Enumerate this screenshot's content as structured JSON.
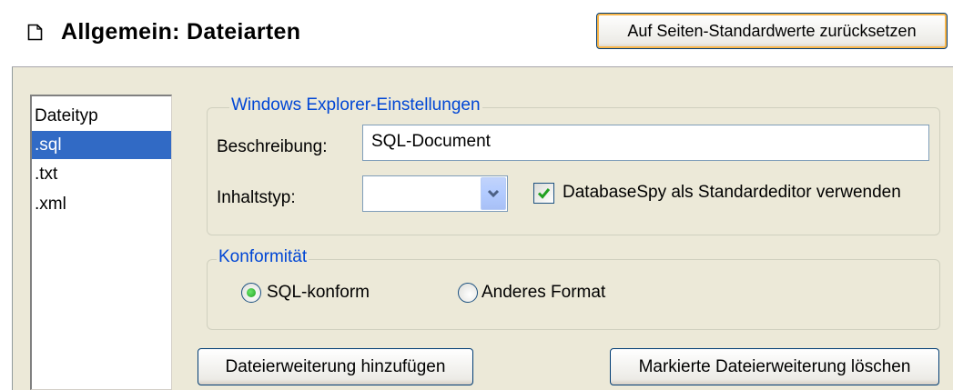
{
  "header": {
    "title": "Allgemein: Dateiarten",
    "reset_button_label": "Auf Seiten-Standardwerte zurücksetzen",
    "page_icon": "page-icon"
  },
  "file_types": {
    "header": "Dateityp",
    "items": [
      ".sql",
      ".txt",
      ".xml"
    ],
    "selected": ".sql"
  },
  "explorer_settings": {
    "legend": "Windows Explorer-Einstellungen",
    "description_label": "Beschreibung:",
    "description_value": "SQL-Document",
    "content_type_label": "Inhaltstyp:",
    "content_type_value": "",
    "default_editor_checkbox_label": "DatabaseSpy als Standardeditor verwenden",
    "default_editor_checked": true
  },
  "conformance": {
    "legend": "Konformität",
    "options": [
      "SQL-konform",
      "Anderes Format"
    ],
    "selected": "SQL-konform"
  },
  "buttons": {
    "add_extension": "Dateierweiterung hinzufügen",
    "delete_extension": "Markierte Dateierweiterung löschen"
  },
  "colors": {
    "group_legend": "#0046d5",
    "selection": "#316ac5",
    "panel_background": "#ece9d8"
  }
}
